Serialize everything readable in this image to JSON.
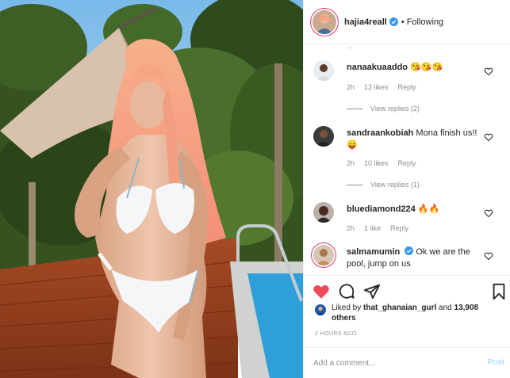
{
  "post": {
    "author": "hajia4reall",
    "follow_state": "Following",
    "separator": "•"
  },
  "comments": [
    {
      "username": "nanaakuaaddo",
      "text": "😘😘😘",
      "time": "2h",
      "likes": "12 likes",
      "reply_label": "Reply",
      "view_replies": "View replies (2)"
    },
    {
      "username": "sandraankobiah",
      "text": "Mona finish us!! 😛",
      "time": "2h",
      "likes": "10 likes",
      "reply_label": "Reply",
      "view_replies": "View replies (1)"
    },
    {
      "username": "bluediamond224",
      "text": "🔥🔥",
      "time": "2h",
      "likes": "1 like",
      "reply_label": "Reply"
    },
    {
      "username": "salmamumin",
      "text": "Ok we are the pool, jump on us"
    }
  ],
  "likes": {
    "prefix": "Liked by ",
    "user": "that_ghanaian_gurl",
    "middle": " and ",
    "others": "13,908 others"
  },
  "timestamp": "2 HOURS AGO",
  "add_comment": {
    "placeholder": "Add a comment...",
    "post_label": "Post"
  },
  "icons": {
    "like": "heart-filled-icon",
    "comment": "comment-bubble-icon",
    "share": "paper-plane-icon",
    "save": "bookmark-icon",
    "verified": "verified-badge-icon"
  },
  "colors": {
    "like_red": "#ed4956",
    "verified_blue": "#3897f0",
    "post_disabled": "#b2dffc",
    "secondary_text": "#8e8e8e"
  }
}
